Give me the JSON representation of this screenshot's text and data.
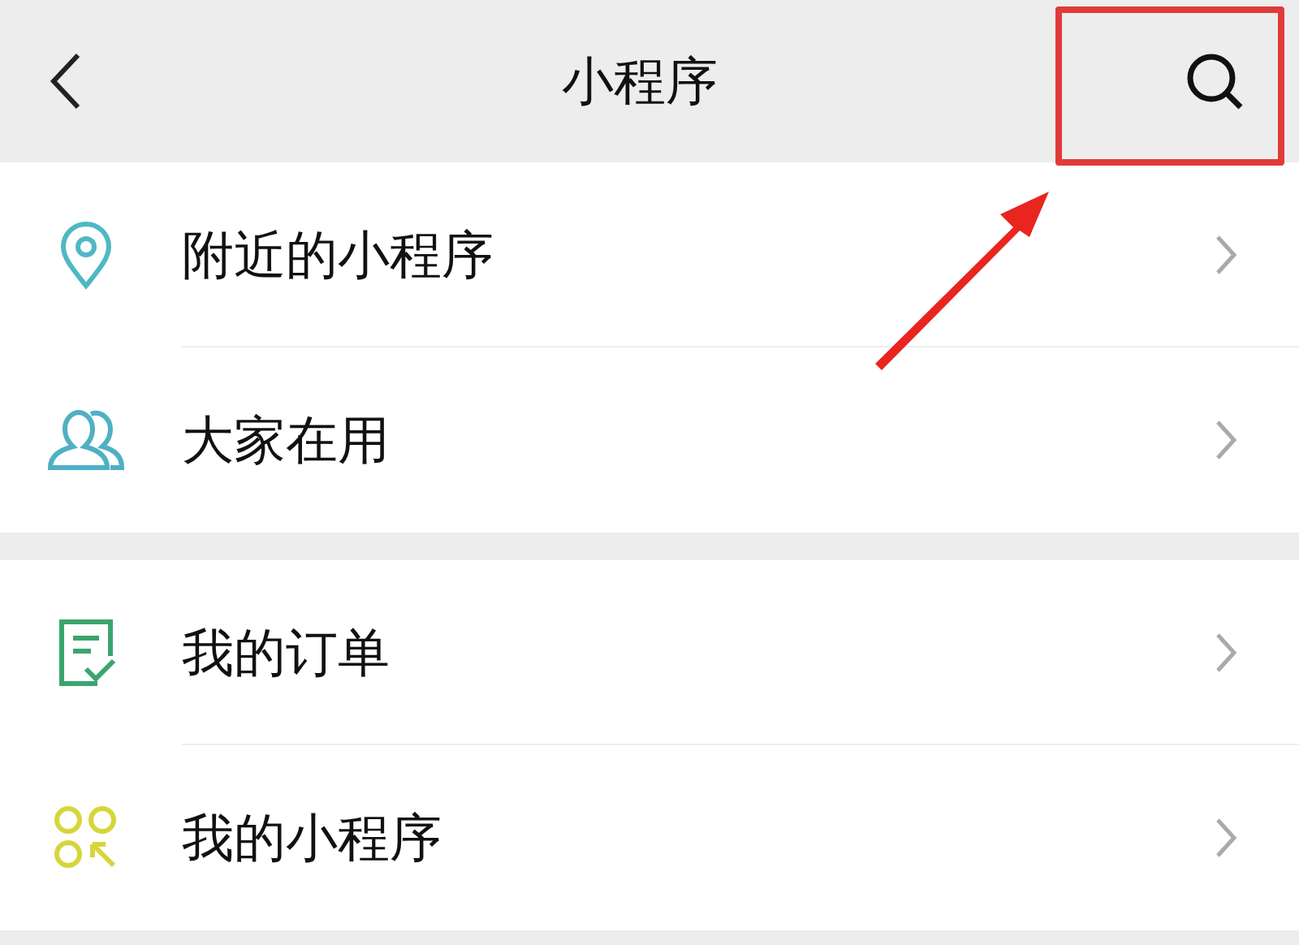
{
  "header": {
    "title": "小程序",
    "search_highlighted": true
  },
  "groups": [
    {
      "items": [
        {
          "kind": "location",
          "label": "附近的小程序"
        },
        {
          "kind": "people",
          "label": "大家在用"
        }
      ]
    },
    {
      "items": [
        {
          "kind": "order",
          "label": "我的订单"
        },
        {
          "kind": "apps",
          "label": "我的小程序"
        }
      ]
    }
  ]
}
